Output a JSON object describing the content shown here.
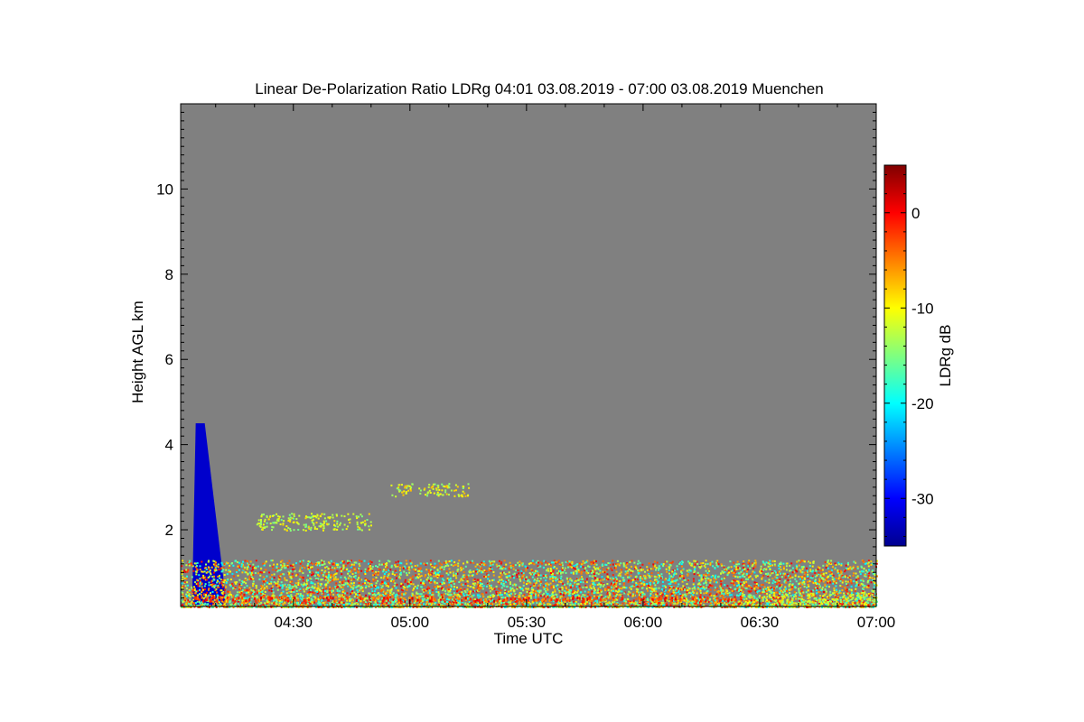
{
  "chart_data": {
    "type": "heatmap",
    "title": "Linear De-Polarization Ratio LDRg   04:01 03.08.2019 - 07:00 03.08.2019 Muenchen",
    "xlabel": "Time UTC",
    "ylabel": "Height AGL km",
    "xlim": [
      "04:01",
      "07:00"
    ],
    "ylim": [
      0.2,
      12.0
    ],
    "x_ticks": [
      "04:30",
      "05:00",
      "05:30",
      "06:00",
      "06:30",
      "07:00"
    ],
    "y_ticks": [
      2,
      4,
      6,
      8,
      10
    ],
    "background_color": "#808080",
    "colorbar": {
      "label": "LDRg dB",
      "range": [
        -35,
        5
      ],
      "ticks": [
        0,
        -10,
        -20,
        -30
      ],
      "colormap": "jet"
    },
    "features": [
      {
        "name": "blue low-LDR column",
        "time_range": [
          "04:03",
          "04:11"
        ],
        "height_range": [
          0.2,
          4.5
        ],
        "ldr_db": -32
      },
      {
        "name": "surface layer speckle",
        "time_range": [
          "04:01",
          "07:00"
        ],
        "height_range": [
          0.2,
          1.3
        ],
        "ldr_db": -10
      },
      {
        "name": "near-surface red band",
        "time_range": [
          "04:01",
          "06:25"
        ],
        "height_range": [
          0.35,
          0.45
        ],
        "ldr_db": -2
      },
      {
        "name": "yellow-green surface layer",
        "time_range": [
          "06:25",
          "07:00"
        ],
        "height_range": [
          0.2,
          0.5
        ],
        "ldr_db": -12
      },
      {
        "name": "layer near 3 km",
        "time_range": [
          "04:55",
          "05:15"
        ],
        "height_range": [
          2.8,
          3.1
        ],
        "ldr_db": -11
      },
      {
        "name": "layer near 2.3 km",
        "time_range": [
          "04:20",
          "04:50"
        ],
        "height_range": [
          2.0,
          2.4
        ],
        "ldr_db": -12
      }
    ]
  }
}
